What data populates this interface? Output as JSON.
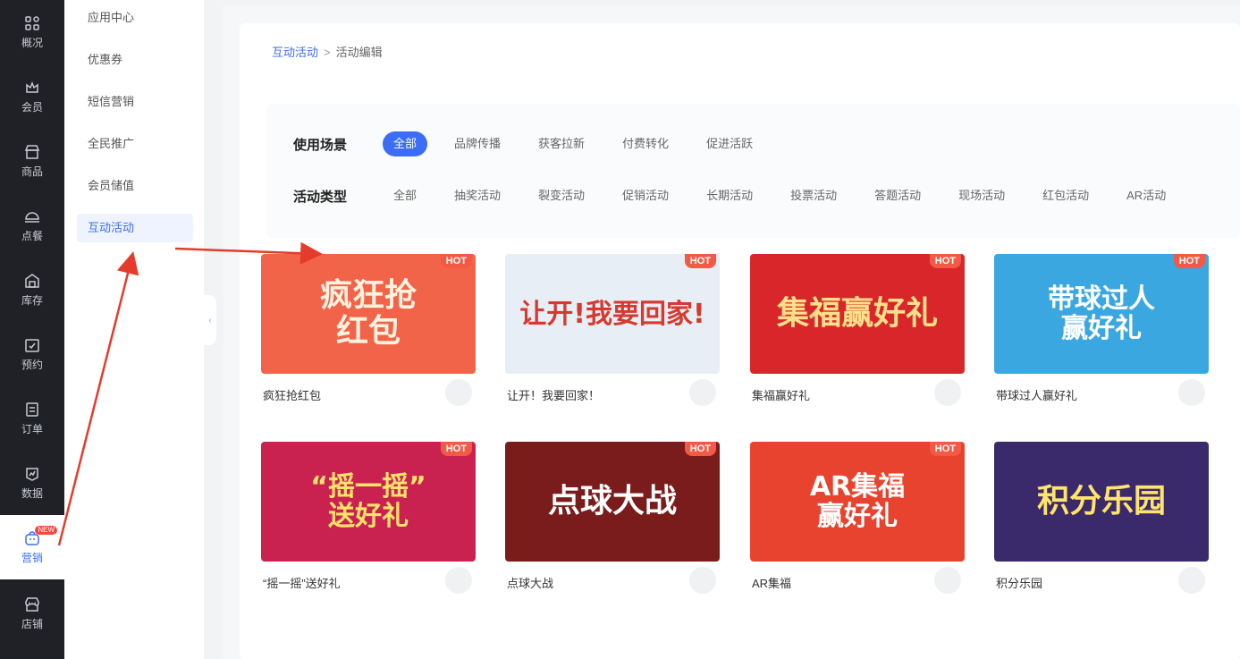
{
  "nav": {
    "items": [
      {
        "label": "概况",
        "icon": "grid-icon"
      },
      {
        "label": "会员",
        "icon": "crown-icon"
      },
      {
        "label": "商品",
        "icon": "store-icon"
      },
      {
        "label": "点餐",
        "icon": "dish-icon"
      },
      {
        "label": "库存",
        "icon": "warehouse-icon"
      },
      {
        "label": "预约",
        "icon": "calendar-check-icon"
      },
      {
        "label": "订单",
        "icon": "order-icon"
      },
      {
        "label": "数据",
        "icon": "chart-icon"
      },
      {
        "label": "营销",
        "icon": "marketing-icon",
        "active": true,
        "badge": "NEW"
      },
      {
        "label": "店铺",
        "icon": "shop-icon"
      }
    ]
  },
  "submenu": {
    "items": [
      "应用中心",
      "优惠券",
      "短信营销",
      "全民推广",
      "会员储值",
      "互动活动"
    ],
    "active_index": 5
  },
  "breadcrumb": {
    "parent": "互动活动",
    "separator": ">",
    "current": "活动编辑"
  },
  "filters": {
    "scene": {
      "title": "使用场景",
      "options": [
        "全部",
        "品牌传播",
        "获客拉新",
        "付费转化",
        "促进活跃"
      ],
      "selected": "全部"
    },
    "type": {
      "title": "活动类型",
      "options": [
        "全部",
        "抽奖活动",
        "裂变活动",
        "促销活动",
        "长期活动",
        "投票活动",
        "答题活动",
        "现场活动",
        "红包活动",
        "AR活动"
      ]
    }
  },
  "cards": [
    {
      "title": "疯狂抢红包",
      "thumb_text": "疯狂抢\n红包",
      "hot": "HOT",
      "bg": "#f2644a",
      "fg": "#fff3e0"
    },
    {
      "title": "让开！我要回家！",
      "thumb_text": "让开!我要回家!",
      "hot": "HOT",
      "bg": "#e8eef5",
      "fg": "#d63a2f"
    },
    {
      "title": "集福赢好礼",
      "thumb_text": "集福赢好礼",
      "hot": "HOT",
      "bg": "#d9262b",
      "fg": "#ffe08a"
    },
    {
      "title": "带球过人赢好礼",
      "thumb_text": "带球过人\n赢好礼",
      "hot": "HOT",
      "bg": "#3aa7e0",
      "fg": "#ffffff"
    },
    {
      "title": "“摇一摇”送好礼",
      "thumb_text": "“摇一摇”\n送好礼",
      "hot": "HOT",
      "bg": "#c92251",
      "fg": "#ffe36b"
    },
    {
      "title": "点球大战",
      "thumb_text": "点球大战",
      "hot": "HOT",
      "bg": "#7a1c1c",
      "fg": "#ffffff"
    },
    {
      "title": "AR集福",
      "thumb_text": "AR集福\n赢好礼",
      "hot": "HOT",
      "bg": "#e8432f",
      "fg": "#ffffff"
    },
    {
      "title": "积分乐园",
      "thumb_text": "积分乐园",
      "hot": "",
      "bg": "#3a2a6b",
      "fg": "#ffe36b"
    }
  ],
  "colors": {
    "accent": "#3b6ef5",
    "nav_bg": "#1f2126",
    "annotation": "#e53b2c"
  }
}
